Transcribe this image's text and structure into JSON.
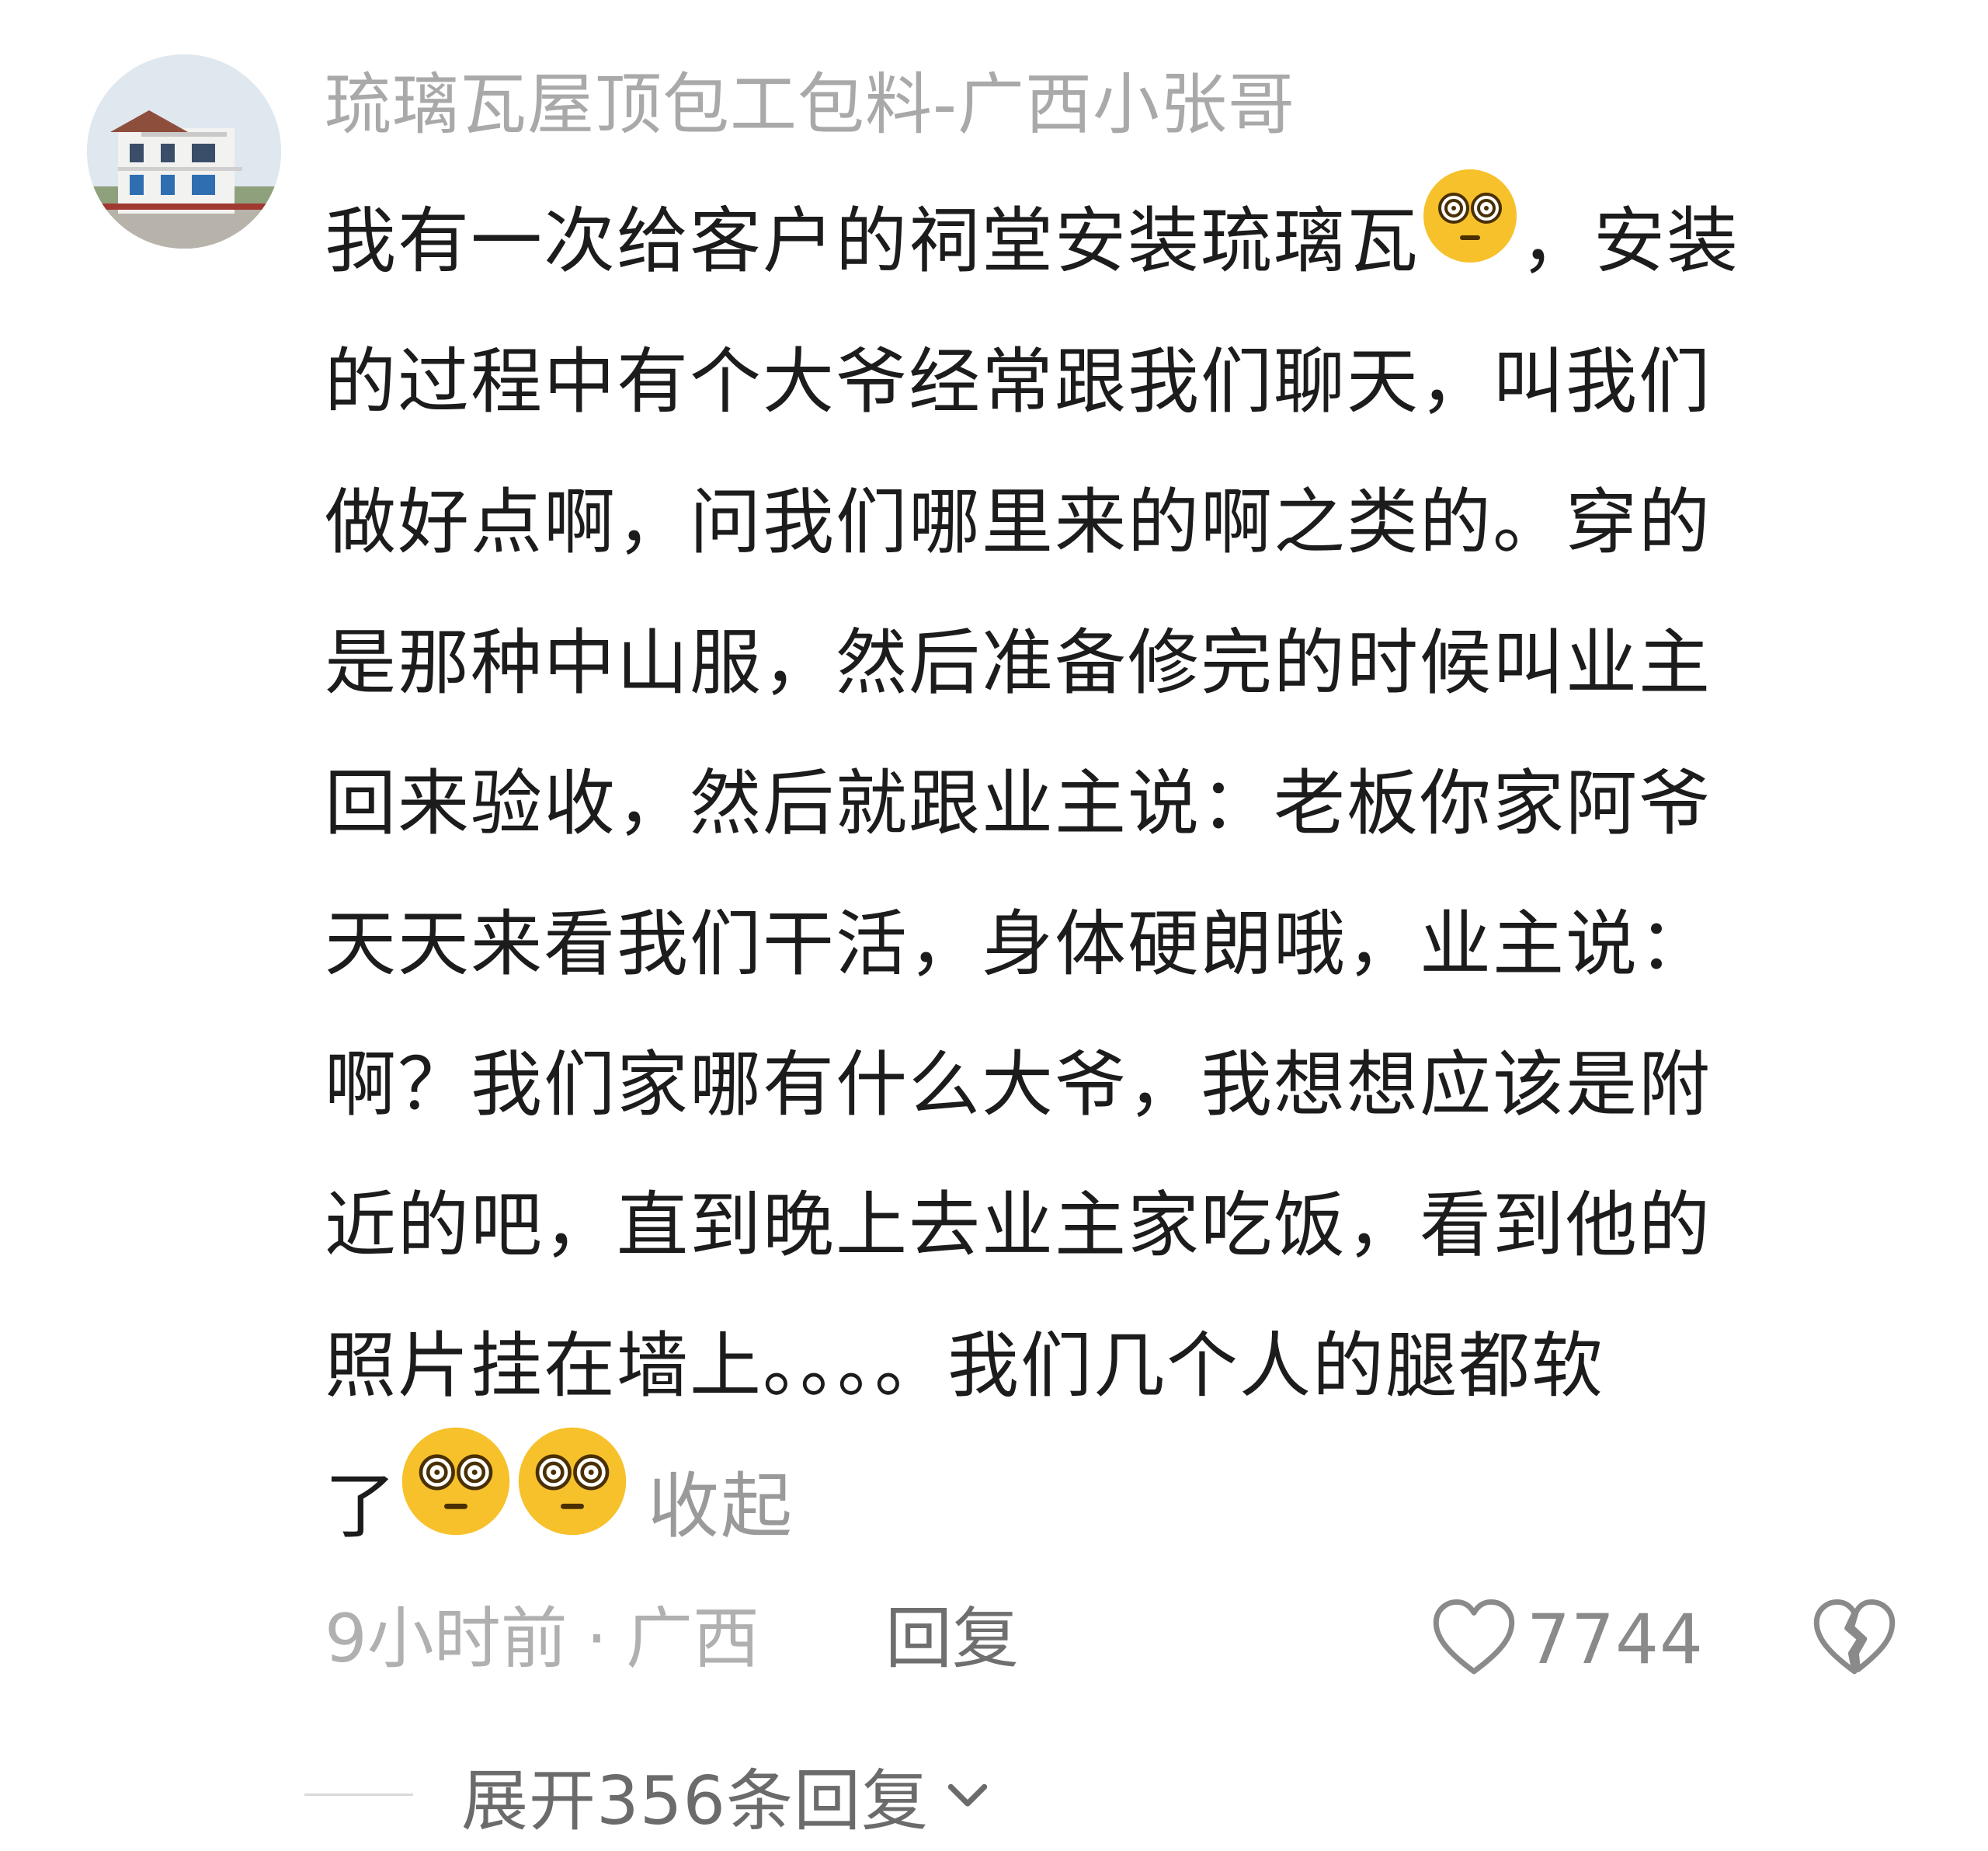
{
  "author": {
    "name": "琉璃瓦屋顶包工包料-广西小张哥",
    "avatar_icon": "house-avatar"
  },
  "comment": {
    "lines": [
      "我有一次给客户的祠堂安装琉璃瓦",
      "，安装",
      "的过程中有个大爷经常跟我们聊天，叫我们",
      "做好点啊，问我们哪里来的啊之类的。穿的",
      "是那种中山服，然后准备修完的时候叫业主",
      "回来验收，然后就跟业主说：老板你家阿爷",
      "天天来看我们干活，身体硬朗哦，业主说：",
      "啊？我们家哪有什么大爷，我想想应该是附",
      "近的吧，直到晚上去业主家吃饭，看到他的",
      "照片挂在墙上。。。。我们几个人的腿都软",
      "了"
    ],
    "emoji_icon": "dizzy-face-emoji",
    "collapse_label": "收起"
  },
  "meta": {
    "time": "9小时前",
    "separator": "·",
    "location": "广西",
    "reply_label": "回复"
  },
  "actions": {
    "like_icon": "heart-icon",
    "like_count": "7744",
    "dislike_icon": "broken-heart-icon"
  },
  "replies": {
    "expand_label": "展开356条回复",
    "expand_icon": "chevron-down-icon"
  },
  "colors": {
    "emoji_face": "#f6c12b",
    "text_primary": "#1c1c1c",
    "text_muted": "#a9a9a9"
  }
}
